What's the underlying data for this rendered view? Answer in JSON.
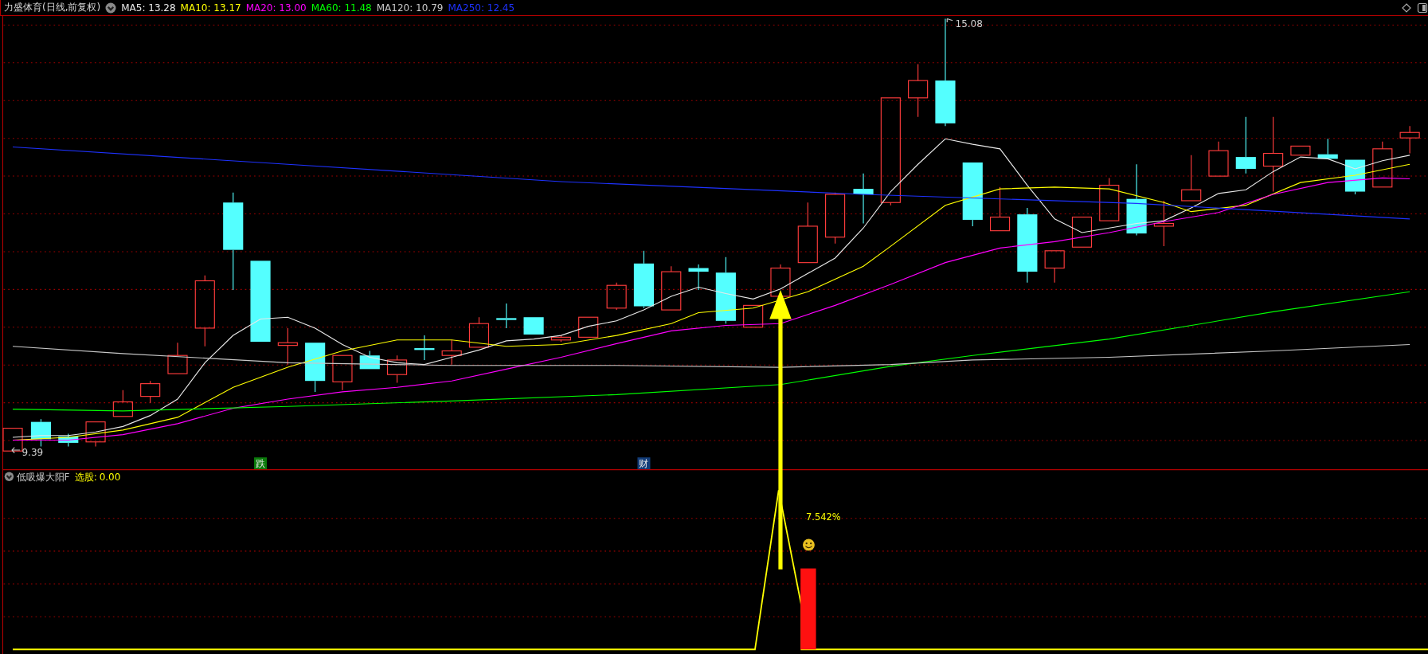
{
  "header": {
    "title": "力盛体育(日线,前复权)",
    "moving_averages": [
      {
        "label": "MA5:",
        "value": "13.28",
        "color": "#e8e8e8"
      },
      {
        "label": "MA10:",
        "value": "13.17",
        "color": "#ffff00"
      },
      {
        "label": "MA20:",
        "value": "13.00",
        "color": "#ff00ff"
      },
      {
        "label": "MA60:",
        "value": "11.48",
        "color": "#00ff00"
      },
      {
        "label": "MA120:",
        "value": "10.79",
        "color": "#c8c8c8"
      },
      {
        "label": "MA250:",
        "value": "12.45",
        "color": "#1e32ff"
      }
    ]
  },
  "price_chart": {
    "high_label": "15.08",
    "low_label": "9.39",
    "event_markers": [
      {
        "text": "跌",
        "color": "#0a7a0a"
      },
      {
        "text": "财",
        "color": "#123c78"
      }
    ]
  },
  "indicator_panel": {
    "name": "低吸爆大阳F",
    "signal_label": "选股:",
    "signal_value": "0.00",
    "gain_label": "7.542%"
  }
}
